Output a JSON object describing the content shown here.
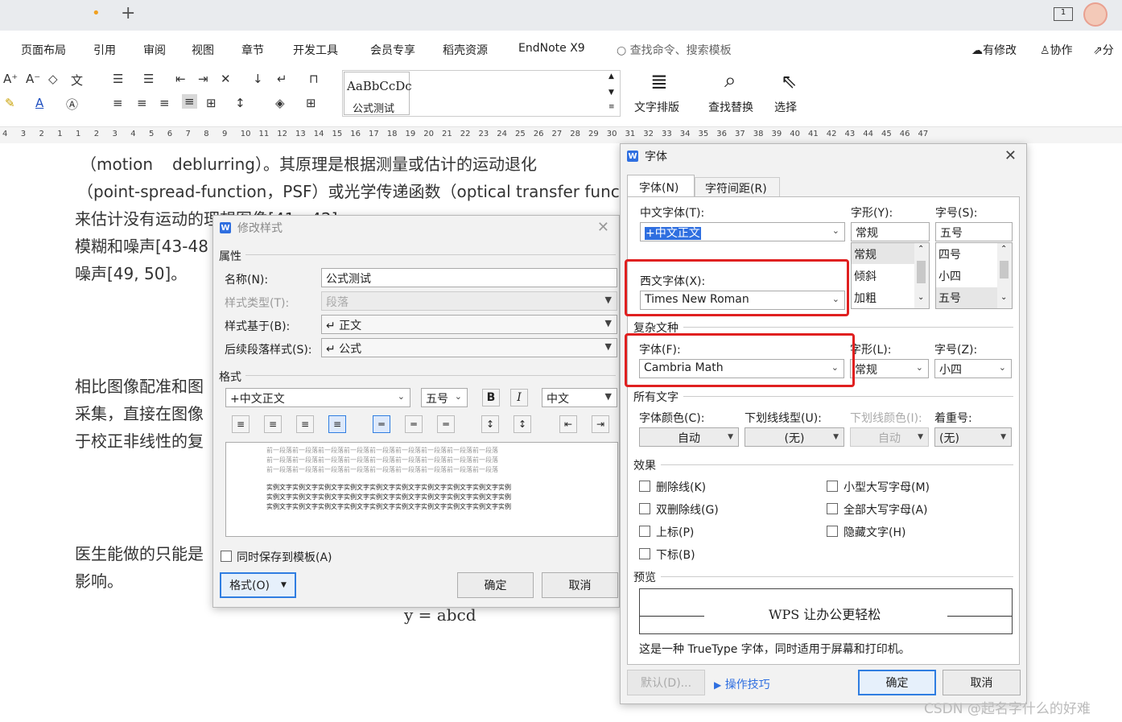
{
  "app": {
    "tab_dot": "•",
    "new_tab": "+",
    "page_badge": "1"
  },
  "menu": {
    "items": [
      "页面布局",
      "引用",
      "审阅",
      "视图",
      "章节",
      "开发工具",
      "会员专享",
      "稻壳资源",
      "EndNote X9"
    ],
    "search": "查找命令、搜索模板",
    "right": [
      "有修改",
      "协作",
      "分"
    ]
  },
  "ribbon": {
    "style_preview": "AaBbCcDc",
    "style_name": "公式测试",
    "text_layout": "文字排版",
    "find_replace": "查找替换",
    "select": "选择"
  },
  "ruler": {
    "nums": [
      "4",
      "3",
      "2",
      "1",
      "1",
      "2",
      "3",
      "4",
      "5",
      "6",
      "7",
      "8",
      "9",
      "10",
      "11",
      "12",
      "13",
      "14",
      "15",
      "16",
      "17",
      "18",
      "19",
      "20",
      "21",
      "22",
      "23",
      "24",
      "25",
      "26",
      "27",
      "28",
      "29",
      "30",
      "31",
      "32",
      "33",
      "34",
      "35",
      "36",
      "37",
      "38",
      "39",
      "40",
      "41",
      "42",
      "43",
      "44",
      "45",
      "46",
      "47"
    ]
  },
  "doc": {
    "l1a": "（motion",
    "l1b": "deblurring）。其原理是根据测量或估计的运动退化",
    "l2": "（point-spread-function，PSF）或光学传递函数（optical transfer functi",
    "l3": "来估计没有运动的理想图像[41，42]",
    "l4": "模糊和噪声[43-48",
    "l5": "噪声[49, 50]。",
    "l6": "相比图像配准和图",
    "l7": "采集，直接在图像",
    "l8": "于校正非线性的复",
    "l9": "医生能做的只能是",
    "l10": "影响。",
    "formula": "y = abcd"
  },
  "modify_style": {
    "title": "修改样式",
    "attributes": "属性",
    "name_label": "名称(N):",
    "name_value": "公式测试",
    "type_label": "样式类型(T):",
    "type_value": "段落",
    "based_label": "样式基于(B):",
    "based_value": "↵ 正文",
    "next_label": "后续段落样式(S):",
    "next_value": "↵ 公式",
    "format_section": "格式",
    "font_value": "+中文正文",
    "size_value": "五号",
    "bold": "B",
    "italic": "I",
    "lang_value": "中文",
    "preview_prev": "前一段落前一段落前一段落前一段落前一段落前一段落前一段落前一段落前一段落",
    "preview_sample": "实例文字实例文字实例文字实例文字实例文字实例文字实例文字实例文字实例文字实例",
    "save_template": "同时保存到模板(A)",
    "format_btn": "格式(O)",
    "ok": "确定",
    "cancel": "取消"
  },
  "font_dialog": {
    "title": "字体",
    "tab_font": "字体(N)",
    "tab_spacing": "字符间距(R)",
    "cn_font_label": "中文字体(T):",
    "cn_font_value": "+中文正文",
    "style_label": "字形(Y):",
    "style_value": "常规",
    "style_list": [
      "常规",
      "倾斜",
      "加粗"
    ],
    "size_label": "字号(S):",
    "size_value": "五号",
    "size_list": [
      "四号",
      "小四",
      "五号"
    ],
    "west_font_label": "西文字体(X):",
    "west_font_value": "Times New Roman",
    "complex_section": "复杂文种",
    "complex_font_label": "字体(F):",
    "complex_font_value": "Cambria Math",
    "complex_style_label": "字形(L):",
    "complex_style_value": "常规",
    "complex_size_label": "字号(Z):",
    "complex_size_value": "小四",
    "all_text_section": "所有文字",
    "color_label": "字体颜色(C):",
    "color_value": "自动",
    "underline_label": "下划线线型(U):",
    "underline_value": "(无)",
    "ucolor_label": "下划线颜色(I):",
    "ucolor_value": "自动",
    "emphasis_label": "着重号:",
    "emphasis_value": "(无)",
    "effects_section": "效果",
    "effects": [
      "删除线(K)",
      "双删除线(G)",
      "上标(P)",
      "下标(B)",
      "小型大写字母(M)",
      "全部大写字母(A)",
      "隐藏文字(H)"
    ],
    "preview_section": "预览",
    "preview_text": "WPS 让办公更轻松",
    "description": "这是一种 TrueType 字体，同时适用于屏幕和打印机。",
    "default_btn": "默认(D)...",
    "tips": "操作技巧",
    "ok": "确定",
    "cancel": "取消"
  },
  "watermark": "CSDN @起名字什么的好难"
}
